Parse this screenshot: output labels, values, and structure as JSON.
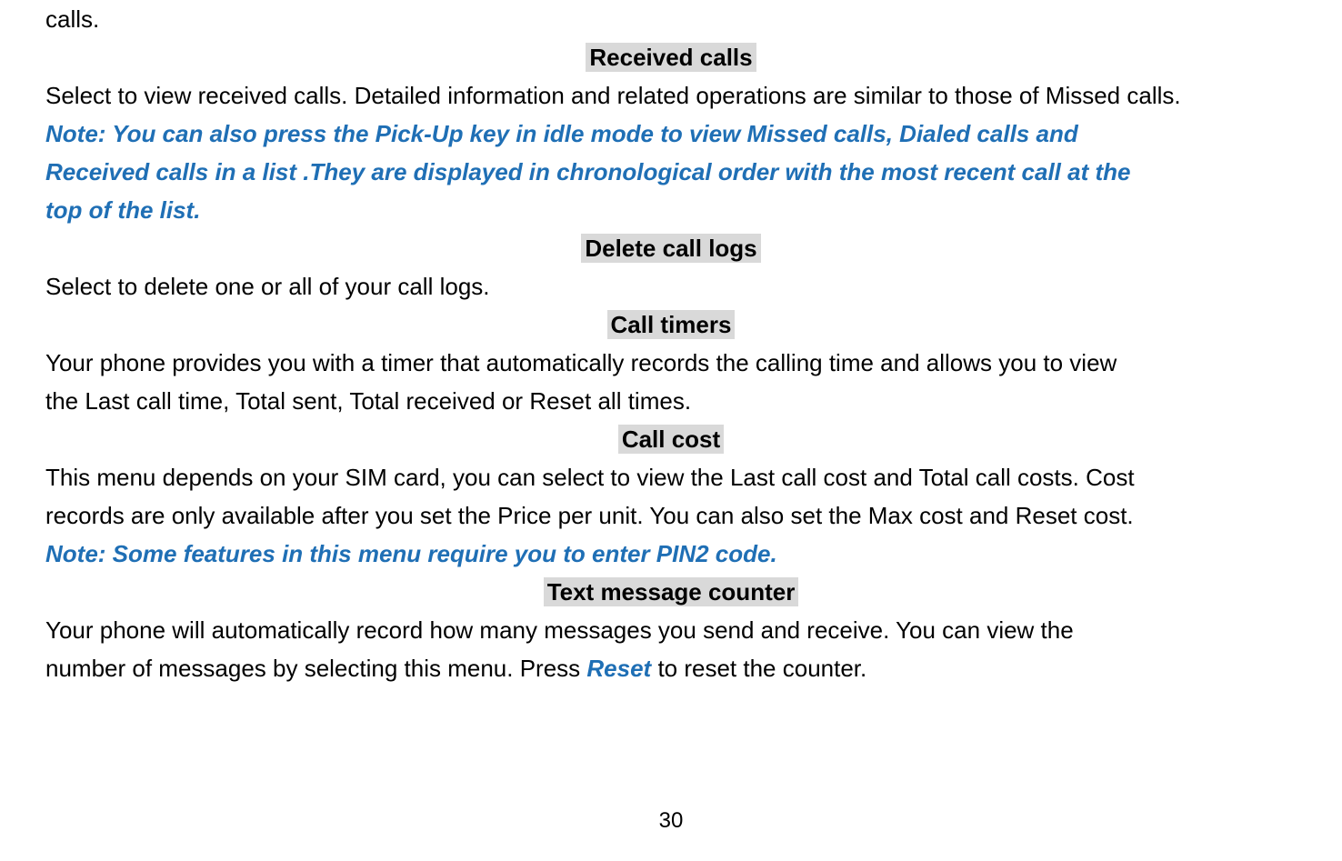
{
  "frag_top": "calls.",
  "sections": {
    "received_calls": {
      "heading": "Received calls",
      "body_last": "Select to view received calls. Detailed information and related operations are similar to those of Missed calls."
    },
    "note1_l1": "Note: You can also press the Pick-Up key in idle mode to view Missed calls, Dialed calls and",
    "note1_l2": "Received calls in a list .They are displayed in chronological order with the most recent call at the",
    "note1_l3": "top of the list.",
    "delete_call_logs": {
      "heading": "Delete call logs",
      "body": "Select to delete one or all of your call logs."
    },
    "call_timers": {
      "heading": "Call timers",
      "body_l1": "Your phone provides you with a timer that automatically records the calling time and allows you to view",
      "body_l2": "the Last call time, Total sent, Total received or Reset all times."
    },
    "call_cost": {
      "heading": "Call cost",
      "body_l1": "This menu depends on your SIM card, you can select to view the Last call cost and Total call costs. Cost",
      "body_l2": "records are only available after you set the Price per unit. You can also set the Max cost and Reset cost."
    },
    "note2": "Note: Some features in this menu require you to enter PIN2 code.",
    "text_msg_counter": {
      "heading": "Text message counter",
      "body_pre": "Your phone will automatically record how many messages you send and receive. You can view the",
      "body_l2_pre": "number of messages by selecting this menu. Press ",
      "reset_kw": "Reset",
      "body_l2_post": " to reset the counter."
    }
  },
  "page_number": "30"
}
